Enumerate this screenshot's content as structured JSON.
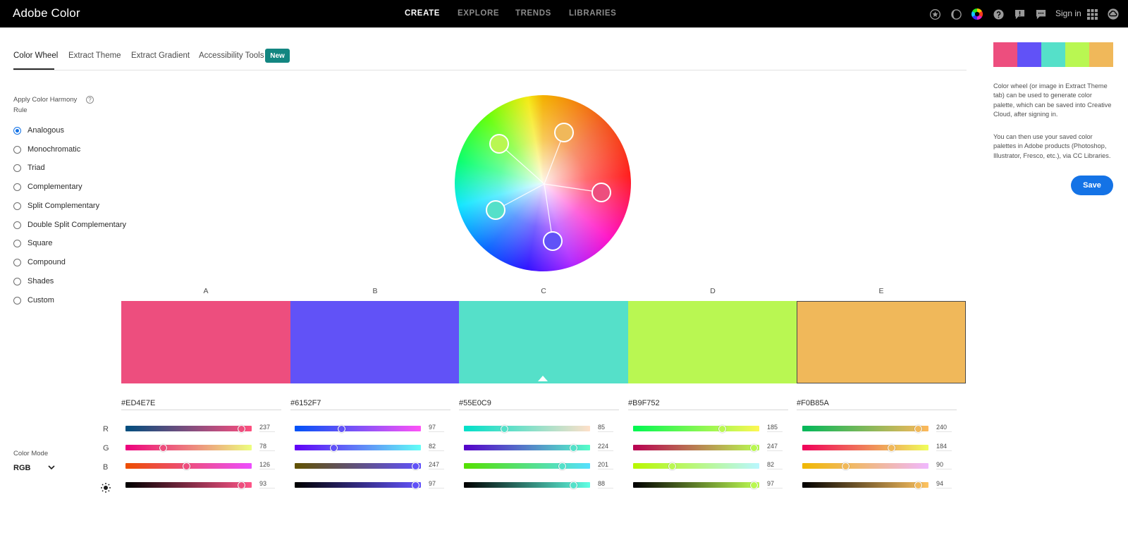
{
  "app": {
    "title": "Adobe Color"
  },
  "nav": {
    "create": "CREATE",
    "explore": "EXPLORE",
    "trends": "TRENDS",
    "libraries": "LIBRARIES"
  },
  "header": {
    "sign_in": "Sign in"
  },
  "tabs": {
    "color_wheel": "Color Wheel",
    "extract_theme": "Extract Theme",
    "extract_gradient": "Extract Gradient",
    "accessibility_tools": "Accessibility Tools",
    "new_badge": "New"
  },
  "harmony": {
    "title": "Apply Color Harmony Rule",
    "help": "?",
    "selected": "Analogous",
    "rules": [
      "Analogous",
      "Monochromatic",
      "Triad",
      "Complementary",
      "Split Complementary",
      "Double Split Complementary",
      "Square",
      "Compound",
      "Shades",
      "Custom"
    ]
  },
  "swatches": [
    {
      "label": "A",
      "hex": "#ED4E7E",
      "color": "#ED4E7E",
      "r": "237",
      "g": "78",
      "b": "126",
      "brightness": "93"
    },
    {
      "label": "B",
      "hex": "#6152F7",
      "color": "#6152F7",
      "r": "97",
      "g": "82",
      "b": "247",
      "brightness": "97"
    },
    {
      "label": "C",
      "hex": "#55E0C9",
      "color": "#55E0C9",
      "r": "85",
      "g": "224",
      "b": "201",
      "brightness": "88"
    },
    {
      "label": "D",
      "hex": "#B9F752",
      "color": "#B9F752",
      "r": "185",
      "g": "247",
      "b": "82",
      "brightness": "97"
    },
    {
      "label": "E",
      "hex": "#F0B85A",
      "color": "#F0B85A",
      "r": "240",
      "g": "184",
      "b": "90",
      "brightness": "94"
    }
  ],
  "selected_swatch": "C",
  "channels": {
    "r": "R",
    "g": "G",
    "b": "B"
  },
  "color_mode": {
    "title": "Color Mode",
    "value": "RGB"
  },
  "sidebar": {
    "description_1": "Color wheel (or image in Extract Theme tab) can be used to generate color palette, which can be saved into Creative Cloud, after signing in.",
    "description_2": "You can then use your saved color palettes in Adobe products (Photoshop, Illustrator, Fresco, etc.), via CC Libraries.",
    "save_label": "Save"
  },
  "icons": [
    "star-icon",
    "moon-icon",
    "color-wheel-icon",
    "help-icon",
    "feedback-icon",
    "chat-icon",
    "apps-grid-icon",
    "creative-cloud-icon",
    "brightness-icon",
    "chevron-down-icon"
  ]
}
